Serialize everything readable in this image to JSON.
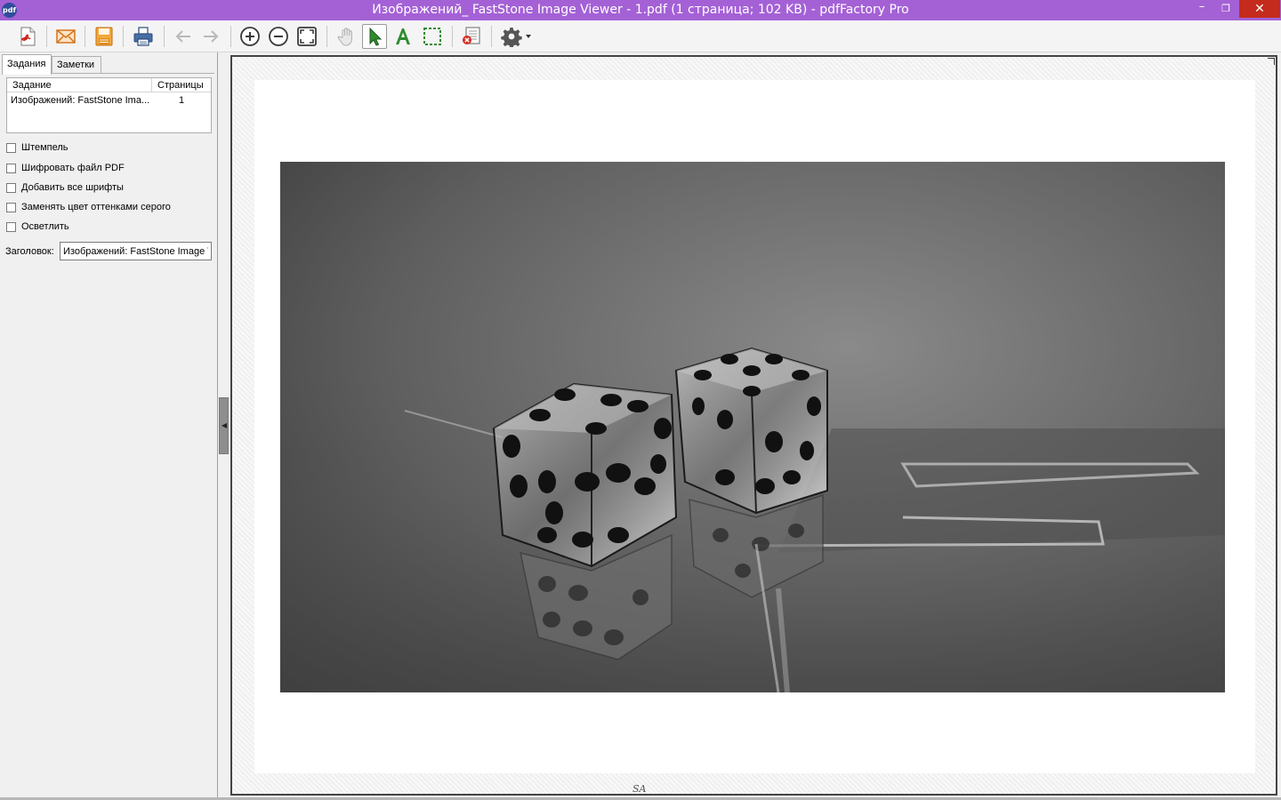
{
  "window": {
    "app_icon_text": "pdf",
    "title": "Изображений_ FastStone Image Viewer - 1.pdf (1 страница; 102 KB) - pdfFactory Pro",
    "minimize": "–",
    "maximize": "❐",
    "close": "✕"
  },
  "tabs": {
    "tasks": "Задания",
    "notes": "Заметки"
  },
  "joblist": {
    "headers": {
      "job": "Задание",
      "pages": "Страницы"
    },
    "rows": [
      {
        "job": "Изображений: FastStone Ima...",
        "pages": "1"
      }
    ]
  },
  "options": [
    {
      "label": "Штемпель",
      "checked": false
    },
    {
      "label": "Шифровать файл PDF",
      "checked": false
    },
    {
      "label": "Добавить все шрифты",
      "checked": false
    },
    {
      "label": "Заменять цвет оттенками серого",
      "checked": false
    },
    {
      "label": "Осветлить",
      "checked": false
    }
  ],
  "title_field": {
    "label": "Заголовок:",
    "value": "Изображений: FastStone Image V"
  },
  "status_mark": "SA",
  "colors": {
    "titlebar": "#a461d6",
    "close_button": "#c42b1c",
    "accent_green": "#2e8b2e"
  }
}
